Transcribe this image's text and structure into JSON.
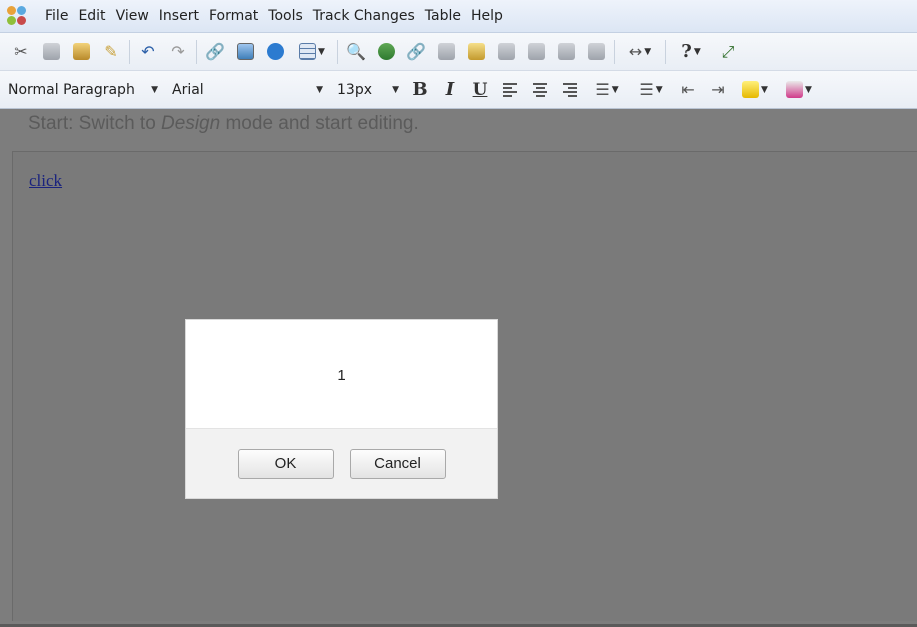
{
  "menubar": {
    "items": [
      "File",
      "Edit",
      "View",
      "Insert",
      "Format",
      "Tools",
      "Track Changes",
      "Table",
      "Help"
    ]
  },
  "toolbar1": {
    "icons": [
      "cut-icon",
      "copy-icon",
      "paste-icon",
      "format-painter-icon",
      "undo-icon",
      "redo-icon",
      "link-icon",
      "image-icon",
      "media-icon",
      "table-icon",
      "find-icon",
      "spellcheck-icon",
      "unlink-icon",
      "track-change-icon",
      "accept-change-icon",
      "reject-change-icon",
      "next-change-icon",
      "prev-change-icon",
      "show-changes-icon",
      "horizontal-rule-icon",
      "help-icon",
      "fullscreen-icon"
    ],
    "help_label": "?"
  },
  "toolbar2": {
    "paragraph_style": "Normal Paragraph",
    "font_family": "Arial",
    "font_size": "13px",
    "bold_label": "B",
    "italic_label": "I",
    "underline_label": "U"
  },
  "editor": {
    "hint_prefix": "Start: Switch to ",
    "hint_mode": "Design",
    "hint_suffix": " mode and start editing.",
    "link_text": "click"
  },
  "dialog": {
    "message": "1",
    "ok_label": "OK",
    "cancel_label": "Cancel"
  },
  "colors": {
    "overlay": "#7d7d7d",
    "link": "#1a237e",
    "dialog_footer": "#f2f2f2"
  }
}
